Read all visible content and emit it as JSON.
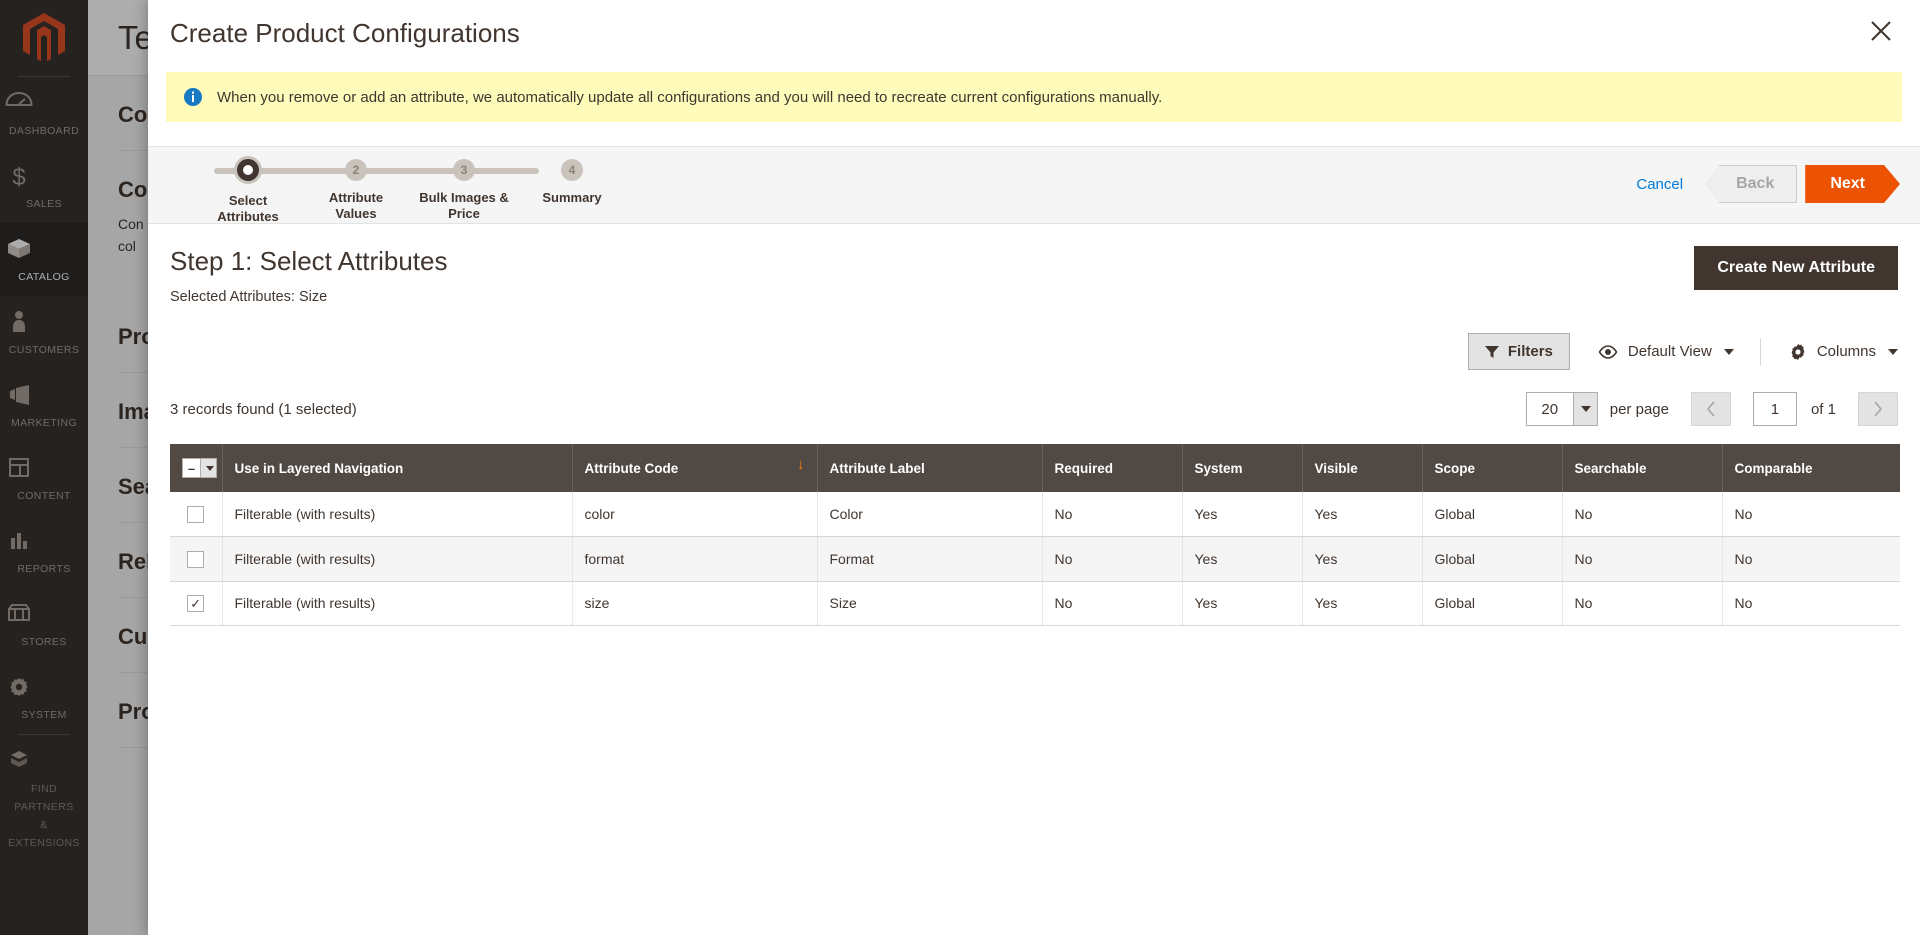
{
  "background": {
    "page_title": "Test",
    "sidebar": {
      "logo_name": "magento-logo-icon",
      "items": [
        {
          "label": "DASHBOARD",
          "icon": "dashboard-icon",
          "active": false
        },
        {
          "label": "SALES",
          "icon": "dollar-icon",
          "active": false
        },
        {
          "label": "CATALOG",
          "icon": "box-icon",
          "active": true
        },
        {
          "label": "CUSTOMERS",
          "icon": "person-icon",
          "active": false
        },
        {
          "label": "MARKETING",
          "icon": "megaphone-icon",
          "active": false
        },
        {
          "label": "CONTENT",
          "icon": "layout-icon",
          "active": false
        },
        {
          "label": "REPORTS",
          "icon": "bar-chart-icon",
          "active": false
        },
        {
          "label": "STORES",
          "icon": "storefront-icon",
          "active": false
        },
        {
          "label": "SYSTEM",
          "icon": "gear-icon",
          "active": false
        },
        {
          "label": "FIND PARTNERS & EXTENSIONS",
          "icon": "extension-icon",
          "active": false
        }
      ]
    },
    "sections": [
      {
        "label": "Con",
        "type": "section"
      },
      {
        "label": "Con",
        "type": "sub"
      },
      {
        "label": "Con\ncol",
        "type": "note"
      },
      {
        "label": "Pro",
        "type": "section"
      },
      {
        "label": "Ima",
        "type": "section"
      },
      {
        "label": "Sea",
        "type": "section"
      },
      {
        "label": "Rela",
        "type": "section"
      },
      {
        "label": "Cus",
        "type": "section"
      },
      {
        "label": "Pro",
        "type": "section"
      }
    ]
  },
  "modal": {
    "title": "Create Product Configurations",
    "close_icon": "close-icon",
    "notice": {
      "icon": "info-icon",
      "text": "When you remove or add an attribute, we automatically update all configurations and you will need to recreate current configurations manually."
    },
    "wizard": {
      "steps": [
        {
          "number": "1",
          "label": "Select\nAttributes",
          "current": true
        },
        {
          "number": "2",
          "label": "Attribute\nValues",
          "current": false
        },
        {
          "number": "3",
          "label": "Bulk Images &\nPrice",
          "current": false
        },
        {
          "number": "4",
          "label": "Summary",
          "current": false
        }
      ],
      "cancel_label": "Cancel",
      "back_label": "Back",
      "next_label": "Next"
    },
    "step": {
      "title": "Step 1: Select Attributes",
      "selected_attributes": "Selected Attributes: Size",
      "create_new_attribute_label": "Create New Attribute"
    },
    "toolbar": {
      "filters_label": "Filters",
      "filters_icon": "funnel-icon",
      "view_label": "Default View",
      "view_icon": "eye-icon",
      "columns_label": "Columns",
      "columns_icon": "gear-icon"
    },
    "pager": {
      "records_found": "3 records found (1 selected)",
      "per_page_value": "20",
      "per_page_label": "per page",
      "prev_icon": "chevron-left-icon",
      "next_icon": "chevron-right-icon",
      "page_value": "1",
      "of_pages": "of 1"
    },
    "grid": {
      "columns": [
        {
          "key": "check",
          "label": "",
          "sorted": false
        },
        {
          "key": "layered",
          "label": "Use in Layered Navigation",
          "sorted": false
        },
        {
          "key": "code",
          "label": "Attribute Code",
          "sorted": true,
          "sort_dir": "desc"
        },
        {
          "key": "label",
          "label": "Attribute Label",
          "sorted": false
        },
        {
          "key": "required",
          "label": "Required",
          "sorted": false
        },
        {
          "key": "system",
          "label": "System",
          "sorted": false
        },
        {
          "key": "visible",
          "label": "Visible",
          "sorted": false
        },
        {
          "key": "scope",
          "label": "Scope",
          "sorted": false
        },
        {
          "key": "searchable",
          "label": "Searchable",
          "sorted": false
        },
        {
          "key": "comparable",
          "label": "Comparable",
          "sorted": false
        }
      ],
      "rows": [
        {
          "selected": false,
          "layered": "Filterable (with results)",
          "code": "color",
          "label": "Color",
          "required": "No",
          "system": "Yes",
          "visible": "Yes",
          "scope": "Global",
          "searchable": "No",
          "comparable": "No"
        },
        {
          "selected": false,
          "layered": "Filterable (with results)",
          "code": "format",
          "label": "Format",
          "required": "No",
          "system": "Yes",
          "visible": "Yes",
          "scope": "Global",
          "searchable": "No",
          "comparable": "No"
        },
        {
          "selected": true,
          "layered": "Filterable (with results)",
          "code": "size",
          "label": "Size",
          "required": "No",
          "system": "Yes",
          "visible": "Yes",
          "scope": "Global",
          "searchable": "No",
          "comparable": "No"
        }
      ]
    }
  },
  "colors": {
    "accent_orange": "#eb5202",
    "link_blue": "#007bdb",
    "sidebar_bg": "#373330",
    "table_header_bg": "#514943",
    "notice_bg": "#fffbbb",
    "dark_button": "#41362f"
  }
}
